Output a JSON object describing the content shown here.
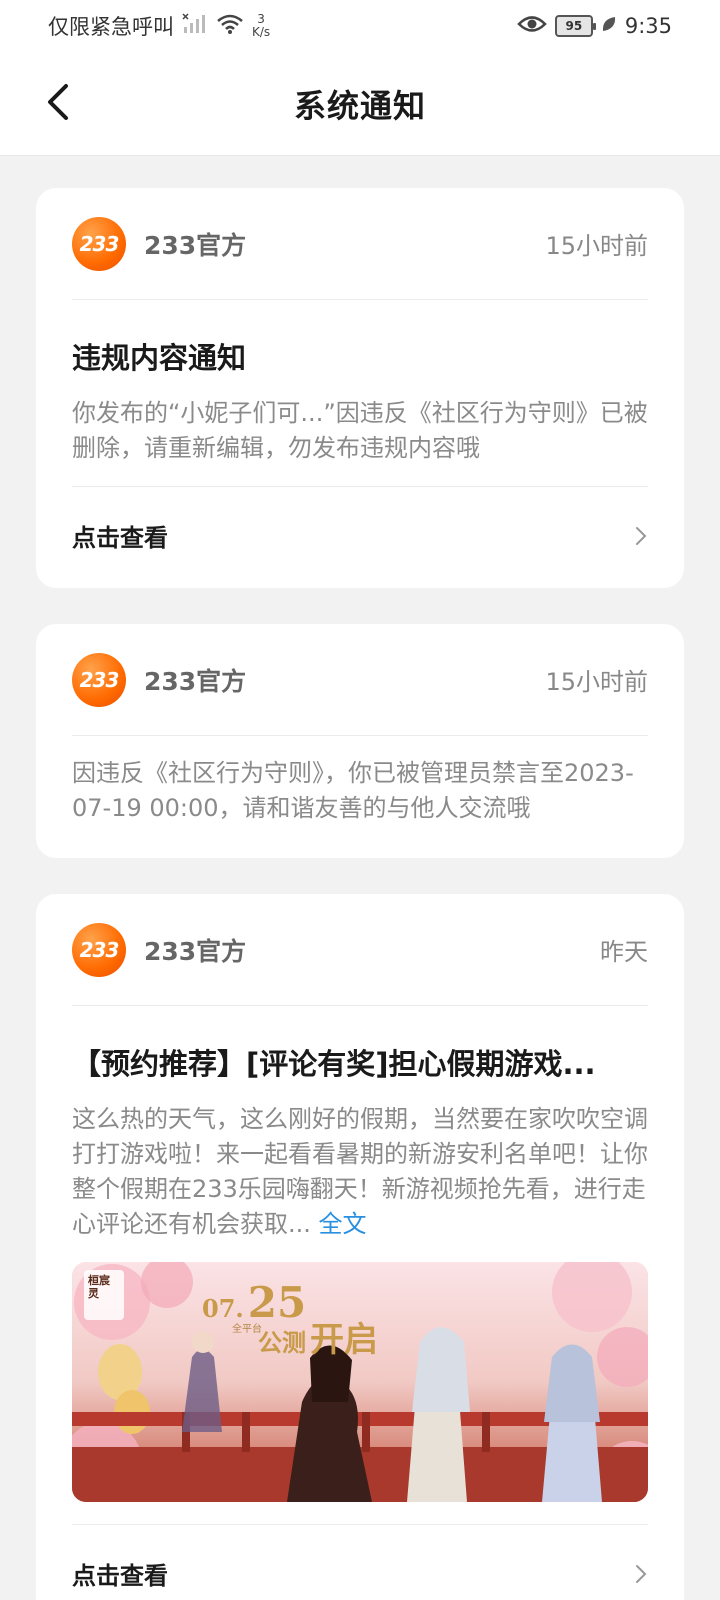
{
  "status_bar": {
    "carrier": "仅限紧急呼叫",
    "speed_value": "3",
    "speed_unit": "K/s",
    "battery": "95",
    "time": "9:35"
  },
  "header": {
    "title": "系统通知"
  },
  "notifications": [
    {
      "logo_text": "233",
      "sender": "233官方",
      "time": "15小时前",
      "title": "违规内容通知",
      "body": "你发布的“小妮子们可...”因违反《社区行为守则》已被删除，请重新编辑，勿发布违规内容哦",
      "action_label": "点击查看"
    },
    {
      "logo_text": "233",
      "sender": "233官方",
      "time": "15小时前",
      "body": "因违反《社区行为守则》，你已被管理员禁言至2023-07-19 00:00，请和谐友善的与他人交流哦"
    },
    {
      "logo_text": "233",
      "sender": "233官方",
      "time": "昨天",
      "title": "【预约推荐】[评论有奖]担心假期游戏...",
      "body": "这么热的天气，这么刚好的假期，当然要在家吹吹空调打打游戏啦！来一起看看暑期的新游安利名单吧！让你整个假期在233乐园嗨翻天！新游视频抢先看，进行走心评论还有机会获取...",
      "more_link": "全文",
      "banner": {
        "logo_text": "桓宸灵",
        "date_month": "07.",
        "date_day": "25",
        "platform": "全平台",
        "event": "公测",
        "event_big": "开启"
      },
      "action_label": "点击查看"
    }
  ]
}
